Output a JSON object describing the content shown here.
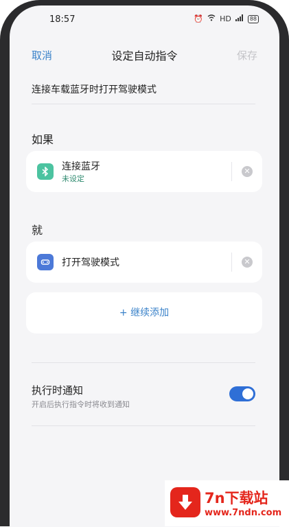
{
  "status": {
    "time": "18:57",
    "network": "HD",
    "battery": "88"
  },
  "nav": {
    "cancel": "取消",
    "title": "设定自动指令",
    "save": "保存"
  },
  "command_name": "连接车载蓝牙时打开驾驶模式",
  "if_section": {
    "title": "如果",
    "card": {
      "title": "连接蓝牙",
      "subtitle": "未设定",
      "icon": "bluetooth-icon",
      "icon_color": "#4cc3a0"
    }
  },
  "then_section": {
    "title": "就",
    "card": {
      "title": "打开驾驶模式",
      "icon": "car-icon",
      "icon_color": "#4c79d8"
    },
    "add_label": "+ 继续添加"
  },
  "notify": {
    "title": "执行时通知",
    "subtitle": "开启后执行指令时将收到通知",
    "enabled": true
  },
  "colors": {
    "accent": "#3a82c9",
    "toggle": "#2f6fd6"
  },
  "watermark": {
    "name": "7n下载站",
    "url": "www.7ndn.com"
  }
}
